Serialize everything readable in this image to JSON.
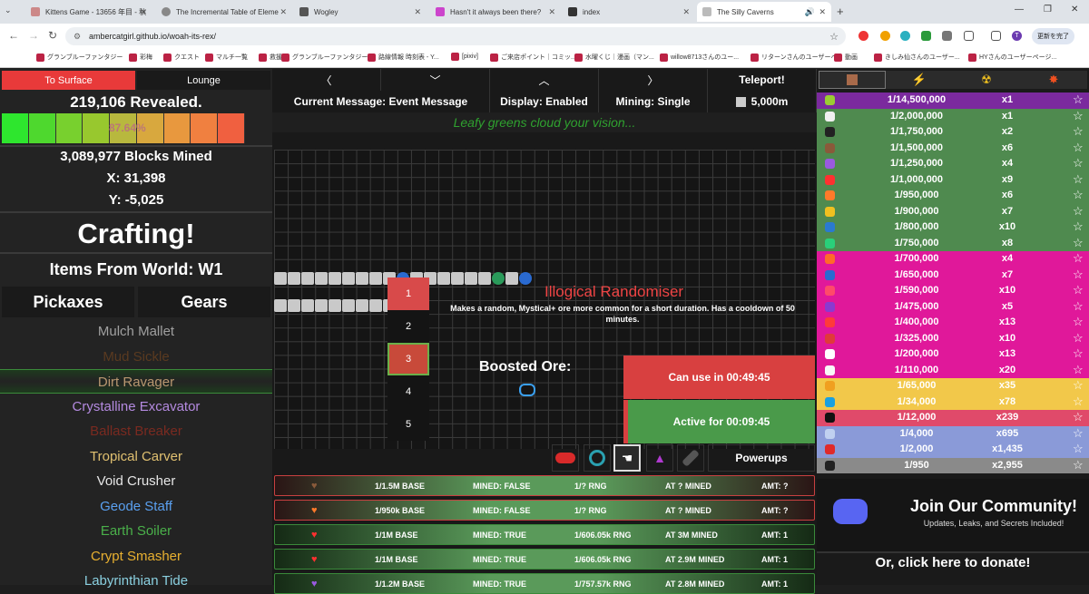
{
  "browser": {
    "tabs": [
      {
        "title": "Kittens Game - 13656 年目 - 秋",
        "color": "#c88"
      },
      {
        "title": "The Incremental Table of Eleme",
        "color": "#888"
      },
      {
        "title": "Wogley",
        "color": "#555"
      },
      {
        "title": "Hasn't it always been there?",
        "color": "#c4c"
      },
      {
        "title": "index",
        "color": "#333"
      },
      {
        "title": "The Silly Caverns",
        "color": "#bbb"
      }
    ],
    "url": "ambercatgirl.github.io/woah-its-rex/",
    "update_label": "更新を完了",
    "profile_letter": "T",
    "bookmarks": [
      "グランブルーファンタジー",
      "彩梅",
      "クエスト",
      "マルチ一覧",
      "救援",
      "グランブルーファンタジー",
      "路線情報 時刻表 - Y...",
      "[pixiv]",
      "ご来店ポイント｜コミッ...",
      "水曜くじ｜漫画（マン...",
      "willow8713さんのユー...",
      "リターンさんのユーザーペ...",
      "動画",
      "きしみ仙さんのユーザー...",
      "HYさんのユーザーページ..."
    ]
  },
  "left": {
    "to_surface": "To Surface",
    "lounge": "Lounge",
    "revealed": "219,106 Revealed.",
    "progress_label": "87.64%",
    "progress_fraction": 0.8764,
    "blocks_mined": "3,089,977 Blocks Mined",
    "x": "X: 31,398",
    "y": "Y: -5,025",
    "crafting": "Crafting!",
    "items_from": "Items From World: W1",
    "pickaxes": "Pickaxes",
    "gears": "Gears",
    "items": [
      {
        "name": "Mulch Mallet",
        "color": "#a0a0a0"
      },
      {
        "name": "Mud Sickle",
        "color": "#5a3a20"
      },
      {
        "name": "Dirt Ravager",
        "color": "#b89770"
      },
      {
        "name": "Crystalline Excavator",
        "color": "#b48ae0"
      },
      {
        "name": "Ballast Breaker",
        "color": "#7a2a20"
      },
      {
        "name": "Tropical Carver",
        "color": "#e0c070"
      },
      {
        "name": "Void Crusher",
        "color": "#e6e6e6"
      },
      {
        "name": "Geode Staff",
        "color": "#5aa0f0"
      },
      {
        "name": "Earth Soiler",
        "color": "#4ab04a"
      },
      {
        "name": "Crypt Smasher",
        "color": "#e8b030"
      },
      {
        "name": "Labyrinthian Tide",
        "color": "#8ad0e0"
      }
    ]
  },
  "center": {
    "current_message": "Current Message: Event Message",
    "display": "Display: Enabled",
    "mining": "Mining: Single",
    "teleport": "Teleport!",
    "depth": "5,000m",
    "message": "Leafy greens cloud your vision...",
    "slots": [
      "1",
      "2",
      "3",
      "4",
      "5"
    ],
    "powerup_title": "Illogical Randomiser",
    "powerup_desc": "Makes a random, Mystical+ ore more common for a short duration. Has a cooldown of 50 minutes.",
    "boosted": "Boosted Ore:",
    "can_use": "Can use in 00:49:45",
    "active": "Active for 00:09:45",
    "powerups": "Powerups",
    "ores": [
      {
        "heart": "#8a5a3a",
        "base": "1/1.5M BASE",
        "mined": "MINED: FALSE",
        "rng": "1/? RNG",
        "at": "AT ? MINED",
        "amt": "AMT: ?",
        "red": true
      },
      {
        "heart": "#ff7a2a",
        "base": "1/950k BASE",
        "mined": "MINED: FALSE",
        "rng": "1/? RNG",
        "at": "AT ? MINED",
        "amt": "AMT: ?",
        "red": true
      },
      {
        "heart": "#ff3030",
        "base": "1/1M BASE",
        "mined": "MINED: TRUE",
        "rng": "1/606.05k RNG",
        "at": "AT 3M MINED",
        "amt": "AMT: 1",
        "red": false
      },
      {
        "heart": "#ff3030",
        "base": "1/1M BASE",
        "mined": "MINED: TRUE",
        "rng": "1/606.05k RNG",
        "at": "AT 2.9M MINED",
        "amt": "AMT: 1",
        "red": false
      },
      {
        "heart": "#9a5ae0",
        "base": "1/1.2M BASE",
        "mined": "MINED: TRUE",
        "rng": "1/757.57k RNG",
        "at": "AT 2.8M MINED",
        "amt": "AMT: 1",
        "red": false
      }
    ]
  },
  "right": {
    "rows": [
      {
        "odds": "1/14,500,000",
        "amt": "x1",
        "bg": "#7b2a9e",
        "icon": "#9acd32"
      },
      {
        "odds": "1/2,000,000",
        "amt": "x1",
        "bg": "#4f8a4f",
        "icon": "#f0f0f0"
      },
      {
        "odds": "1/1,750,000",
        "amt": "x2",
        "bg": "#4f8a4f",
        "icon": "#222"
      },
      {
        "odds": "1/1,500,000",
        "amt": "x6",
        "bg": "#4f8a4f",
        "icon": "#8a5a3a"
      },
      {
        "odds": "1/1,250,000",
        "amt": "x4",
        "bg": "#4f8a4f",
        "icon": "#9a5ae0"
      },
      {
        "odds": "1/1,000,000",
        "amt": "x9",
        "bg": "#4f8a4f",
        "icon": "#ff3030"
      },
      {
        "odds": "1/950,000",
        "amt": "x6",
        "bg": "#4f8a4f",
        "icon": "#ff7a2a"
      },
      {
        "odds": "1/900,000",
        "amt": "x7",
        "bg": "#4f8a4f",
        "icon": "#f0c020"
      },
      {
        "odds": "1/800,000",
        "amt": "x10",
        "bg": "#4f8a4f",
        "icon": "#2a7ad0"
      },
      {
        "odds": "1/750,000",
        "amt": "x8",
        "bg": "#4f8a4f",
        "icon": "#2ad07a"
      },
      {
        "odds": "1/700,000",
        "amt": "x4",
        "bg": "#e0189a",
        "icon": "#ff6a2a"
      },
      {
        "odds": "1/650,000",
        "amt": "x7",
        "bg": "#e0189a",
        "icon": "#2a6ad0"
      },
      {
        "odds": "1/590,000",
        "amt": "x10",
        "bg": "#e0189a",
        "icon": "#ff4a6a"
      },
      {
        "odds": "1/475,000",
        "amt": "x5",
        "bg": "#e0189a",
        "icon": "#8a3ad0"
      },
      {
        "odds": "1/400,000",
        "amt": "x13",
        "bg": "#e0189a",
        "icon": "#ff3a3a"
      },
      {
        "odds": "1/325,000",
        "amt": "x10",
        "bg": "#e0189a",
        "icon": "#e03a3a"
      },
      {
        "odds": "1/200,000",
        "amt": "x13",
        "bg": "#e0189a",
        "icon": "#ffffff"
      },
      {
        "odds": "1/110,000",
        "amt": "x20",
        "bg": "#e0189a",
        "icon": "#f8f8f8"
      },
      {
        "odds": "1/65,000",
        "amt": "x35",
        "bg": "#f2c84a",
        "icon": "#f0a020"
      },
      {
        "odds": "1/34,000",
        "amt": "x78",
        "bg": "#f2c84a",
        "icon": "#1aa0e0"
      },
      {
        "odds": "1/12,000",
        "amt": "x239",
        "bg": "#e04a6a",
        "icon": "#111"
      },
      {
        "odds": "1/4,000",
        "amt": "x695",
        "bg": "#8a9ad8",
        "icon": "#c0d0f0"
      },
      {
        "odds": "1/2,000",
        "amt": "x1,435",
        "bg": "#8a9ad8",
        "icon": "#e02a2a"
      },
      {
        "odds": "1/950",
        "amt": "x2,955",
        "bg": "#8a8a8a",
        "icon": "#222"
      }
    ],
    "community_title": "Join Our Community!",
    "community_sub": "Updates, Leaks, and Secrets Included!",
    "donate": "Or, click here to donate!"
  }
}
